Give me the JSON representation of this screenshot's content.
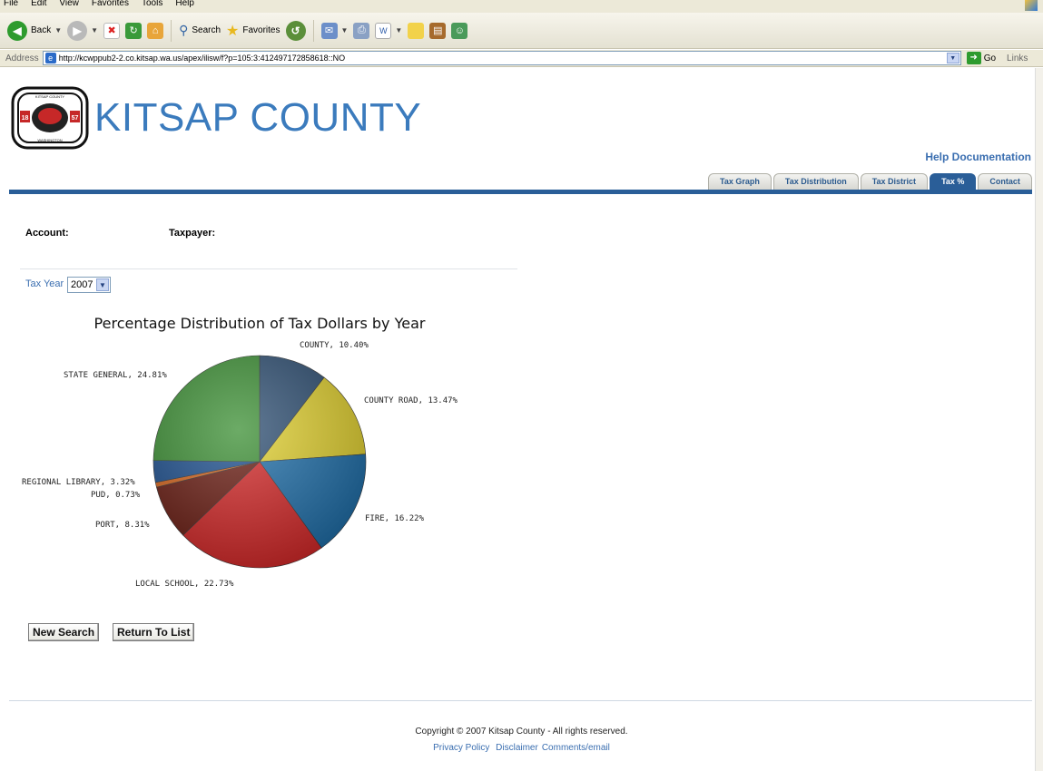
{
  "browser": {
    "menu": [
      "File",
      "Edit",
      "View",
      "Favorites",
      "Tools",
      "Help"
    ],
    "toolbar": {
      "back_label": "Back",
      "search_label": "Search",
      "favorites_label": "Favorites"
    },
    "address": {
      "label": "Address",
      "url": "http://kcwppub2-2.co.kitsap.wa.us/apex/ilisw/f?p=105:3:412497172858618::NO",
      "go_label": "Go",
      "links_label": "Links"
    }
  },
  "site": {
    "title": "KITSAP COUNTY",
    "help_link": "Help Documentation",
    "tabs": [
      {
        "label": "Tax Graph",
        "active": false
      },
      {
        "label": "Tax Distribution",
        "active": false
      },
      {
        "label": "Tax District",
        "active": false
      },
      {
        "label": "Tax %",
        "active": true
      },
      {
        "label": "Contact",
        "active": false
      }
    ],
    "logo": {
      "top_text": "KITSAP COUNTY",
      "bottom_text": "WASHINGTON",
      "year_left": "18",
      "year_right": "57"
    }
  },
  "main": {
    "account_label": "Account:",
    "taxpayer_label": "Taxpayer:",
    "tax_year_label": "Tax Year",
    "tax_year_value": "2007",
    "buttons": {
      "new_search": "New Search",
      "return_to_list": "Return To List"
    }
  },
  "chart_data": {
    "type": "pie",
    "title": "Percentage Distribution of Tax Dollars by Year",
    "slices": [
      {
        "label": "COUNTY",
        "value": 10.4,
        "text": "COUNTY, 10.40%",
        "color": "#2e4f73"
      },
      {
        "label": "COUNTY ROAD",
        "value": 13.47,
        "text": "COUNTY ROAD, 13.47%",
        "color": "#e2d12f"
      },
      {
        "label": "FIRE",
        "value": 16.22,
        "text": "FIRE, 16.22%",
        "color": "#1f6faa"
      },
      {
        "label": "LOCAL SCHOOL",
        "value": 22.73,
        "text": "LOCAL SCHOOL, 22.73%",
        "color": "#d52828"
      },
      {
        "label": "PORT",
        "value": 8.31,
        "text": "PORT, 8.31%",
        "color": "#6a1c12"
      },
      {
        "label": "PUD",
        "value": 0.73,
        "text": "PUD, 0.73%",
        "color": "#d8651c"
      },
      {
        "label": "REGIONAL LIBRARY",
        "value": 3.32,
        "text": "REGIONAL LIBRARY, 3.32%",
        "color": "#1c4f8f"
      },
      {
        "label": "STATE GENERAL",
        "value": 24.81,
        "text": "STATE GENERAL, 24.81%",
        "color": "#3b8f33"
      }
    ]
  },
  "footer": {
    "copyright": "Copyright © 2007 Kitsap County  -  All rights reserved.",
    "links": [
      "Privacy Policy",
      "Disclaimer",
      "Comments/email"
    ]
  }
}
